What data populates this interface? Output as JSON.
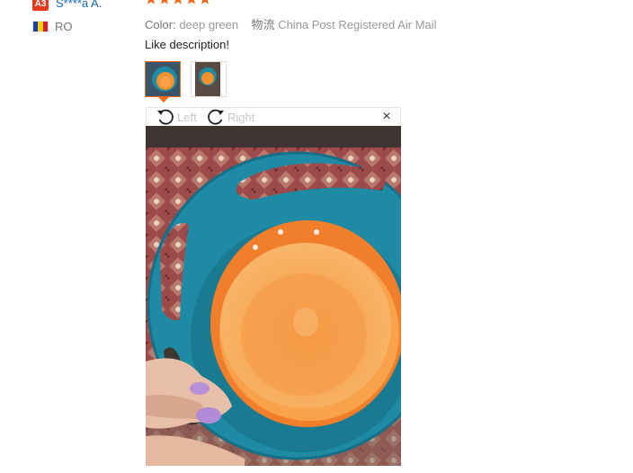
{
  "reviewer": {
    "badge": "A3",
    "name": "S****a A.",
    "country": "RO"
  },
  "rating": {
    "stars": 5,
    "max": 5,
    "color": "#f26b1a"
  },
  "meta": {
    "color_label": "Color:",
    "color_value": "deep green",
    "logistics_label": "物流",
    "logistics_value": "China Post Registered Air Mail"
  },
  "review_text": "Like description!",
  "photo_toolbar": {
    "rotate_left": "Left",
    "rotate_right": "Right",
    "close": "×"
  },
  "colors": {
    "accent": "#f26b1a",
    "link": "#1a66b8",
    "badge": "#e63b1f",
    "bowl_teal": "#1f8aa3",
    "bowl_orange": "#f5902e"
  }
}
